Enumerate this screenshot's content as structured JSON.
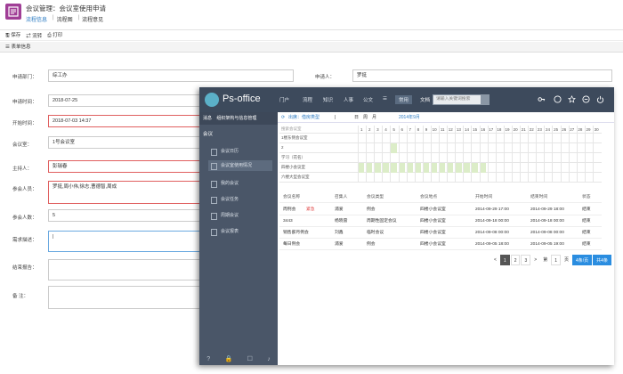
{
  "header": {
    "title": "会议管理：会议室使用申请",
    "tabs": [
      "流程信息",
      "流程图",
      "流程意见"
    ],
    "active_tab": "流程信息"
  },
  "toolbar": {
    "save": "保存",
    "submit": "流转",
    "print": "打印"
  },
  "section": {
    "title": "表单信息"
  },
  "form": {
    "dept_label": "申请部门：",
    "dept_value": "综工办",
    "applicant_label": "申请人：",
    "applicant_value": "罗挺",
    "apply_time_label": "申请时间：",
    "apply_time_value": "2018-07-25",
    "start_time_label": "开始时间：",
    "start_time_value": "2018-07-03 14:37",
    "room_label": "会议室：",
    "room_value": "1号会议室",
    "host_label": "主持人：",
    "host_value": "彭瑞春",
    "attendees_label": "参会人员：",
    "attendees_value": "罗挺,周小伟,徐志,曹德智,周成",
    "count_label": "参会人数：",
    "count_value": "5",
    "desc_label": "需求描述：",
    "desc_value": "|",
    "report_label": "结束报告：",
    "note_label": "备  注："
  },
  "overlay": {
    "logo_text": "Ps-office",
    "nav": [
      "门户",
      "流程",
      "知识",
      "人事",
      "公文"
    ],
    "nav_active": "常用",
    "doc_label": "文档",
    "search_placeholder": "请输入关键词搜索",
    "side_top": [
      "消息",
      "组织架构与信息管理"
    ],
    "side_heading": "会议",
    "side_items": [
      "会议日历",
      "会议室使用情况",
      "我的会议",
      "会议任务",
      "周期会议",
      "会议报表"
    ],
    "side_selected": 1,
    "toolbar_items": [
      "日",
      "周",
      "月",
      "2014年9月"
    ],
    "toolbar_caption": "出席：借房类型",
    "search_room": "搜索会议室",
    "days": [
      "1",
      "2",
      "3",
      "4",
      "5",
      "6",
      "7",
      "8",
      "9",
      "10",
      "11",
      "12",
      "13",
      "14",
      "15",
      "16",
      "17",
      "18",
      "19",
      "20",
      "21",
      "22",
      "23",
      "24",
      "25",
      "26",
      "27",
      "28",
      "29",
      "30"
    ],
    "rooms": [
      "1楼东侧会议室",
      "2",
      "学习（花名）",
      "四楼小会议室",
      "六楼大型会议室"
    ],
    "table_headers": [
      "会议名称",
      "召集人",
      "会议类型",
      "会议地点",
      "开始时间",
      "结束时间",
      "状态"
    ],
    "rows": [
      {
        "name": "周例会",
        "tag": "紧急",
        "host": "浦爱",
        "type": "例会",
        "place": "四楼小会议室",
        "start": "2014-09-29 17:00",
        "end": "2014-09-29 18:00",
        "status": "结束"
      },
      {
        "name": "3443",
        "tag": "",
        "host": "杨晓雷",
        "type": "周期性固定会议",
        "place": "四楼小会议室",
        "start": "2014-09-18 00:00",
        "end": "2014-09-18 00:00",
        "status": "结束"
      },
      {
        "name": "销售部月例会",
        "tag": "",
        "host": "刘鑫",
        "type": "临时会议",
        "place": "四楼小会议室",
        "start": "2014-09-08 00:00",
        "end": "2014-09-08 00:00",
        "status": "结束"
      },
      {
        "name": "每日例会",
        "tag": "",
        "host": "浦爱",
        "type": "例会",
        "place": "四楼小会议室",
        "start": "2014-09-05 18:00",
        "end": "2014-09-05 19:00",
        "status": "结束"
      }
    ],
    "pager": {
      "prev": "<",
      "pages": [
        "1",
        "2",
        "3"
      ],
      "next": ">",
      "goto": "第",
      "page_unit": "1",
      "page": "页",
      "go": "确定",
      "per_page": "4条/页",
      "total": "共4条"
    }
  }
}
